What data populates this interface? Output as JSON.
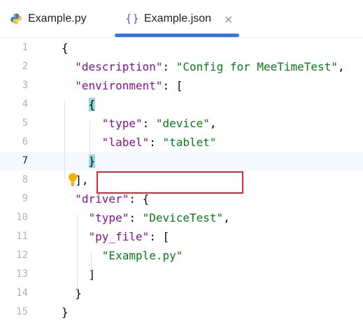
{
  "tabs": [
    {
      "label": "Example.py",
      "icon": "python-icon",
      "active": false
    },
    {
      "label": "Example.json",
      "icon": "json-braces-icon",
      "active": true,
      "close": "×"
    }
  ],
  "editor": {
    "current_line": 7,
    "lines": [
      {
        "no": "1",
        "tokens": [
          {
            "t": "{",
            "c": "punc"
          }
        ]
      },
      {
        "no": "2",
        "tokens": [
          {
            "t": "  "
          },
          {
            "t": "\"description\"",
            "c": "key"
          },
          {
            "t": ": ",
            "c": "punc"
          },
          {
            "t": "\"Config for MeeTimeTest\"",
            "c": "str"
          },
          {
            "t": ",",
            "c": "punc"
          }
        ]
      },
      {
        "no": "3",
        "tokens": [
          {
            "t": "  "
          },
          {
            "t": "\"environment\"",
            "c": "key"
          },
          {
            "t": ": [",
            "c": "punc"
          }
        ]
      },
      {
        "no": "4",
        "tokens": [
          {
            "t": "    "
          },
          {
            "t": "{",
            "c": "punc brace-hl"
          }
        ]
      },
      {
        "no": "5",
        "tokens": [
          {
            "t": "      "
          },
          {
            "t": "\"type\"",
            "c": "key"
          },
          {
            "t": ": ",
            "c": "punc"
          },
          {
            "t": "\"device\"",
            "c": "str"
          },
          {
            "t": ",",
            "c": "punc"
          }
        ]
      },
      {
        "no": "6",
        "tokens": [
          {
            "t": "      "
          },
          {
            "t": "\"label\"",
            "c": "key"
          },
          {
            "t": ": ",
            "c": "punc"
          },
          {
            "t": "\"tablet\"",
            "c": "str"
          }
        ]
      },
      {
        "no": "7",
        "tokens": [
          {
            "t": "    "
          },
          {
            "t": "}",
            "c": "punc brace-hl"
          }
        ]
      },
      {
        "no": "8",
        "tokens": [
          {
            "t": "  "
          },
          {
            "t": "],",
            "c": "punc"
          }
        ]
      },
      {
        "no": "9",
        "tokens": [
          {
            "t": "  "
          },
          {
            "t": "\"driver\"",
            "c": "key"
          },
          {
            "t": ": {",
            "c": "punc"
          }
        ]
      },
      {
        "no": "10",
        "tokens": [
          {
            "t": "    "
          },
          {
            "t": "\"type\"",
            "c": "key"
          },
          {
            "t": ": ",
            "c": "punc"
          },
          {
            "t": "\"DeviceTest\"",
            "c": "str"
          },
          {
            "t": ",",
            "c": "punc"
          }
        ]
      },
      {
        "no": "11",
        "tokens": [
          {
            "t": "    "
          },
          {
            "t": "\"py_file\"",
            "c": "key"
          },
          {
            "t": ": [",
            "c": "punc"
          }
        ]
      },
      {
        "no": "12",
        "tokens": [
          {
            "t": "      "
          },
          {
            "t": "\"Example.py\"",
            "c": "str"
          }
        ]
      },
      {
        "no": "13",
        "tokens": [
          {
            "t": "    "
          },
          {
            "t": "]",
            "c": "punc"
          }
        ]
      },
      {
        "no": "14",
        "tokens": [
          {
            "t": "  "
          },
          {
            "t": "}",
            "c": "punc"
          }
        ]
      },
      {
        "no": "15",
        "tokens": [
          {
            "t": "}",
            "c": "punc"
          }
        ]
      }
    ]
  },
  "annotations": {
    "highlight_box": "red-box around line 6",
    "intention_icon": "lightbulb-icon"
  },
  "colors": {
    "key": "#871094",
    "string": "#067d17",
    "accent": "#3574f0",
    "highlight": "#e0282e",
    "brace_match": "#93d9d9"
  }
}
